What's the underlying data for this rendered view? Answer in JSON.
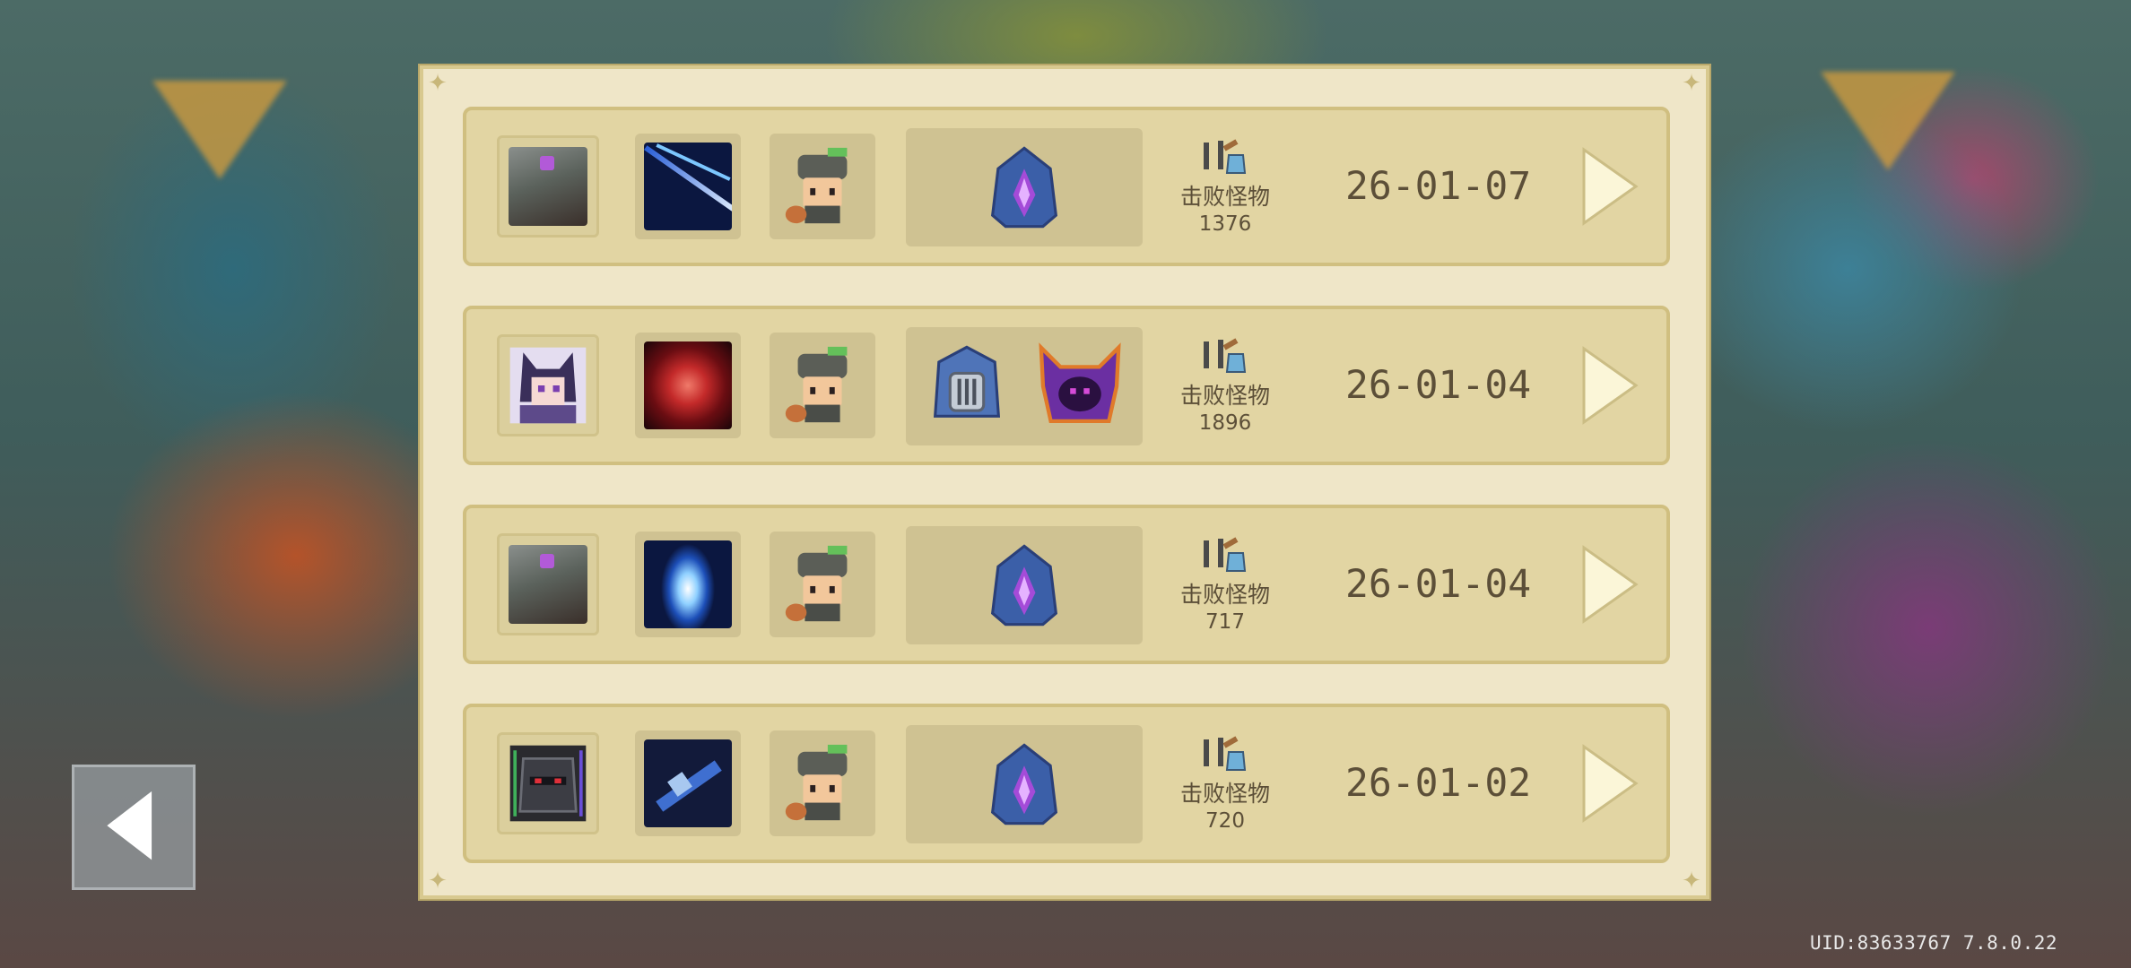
{
  "records": [
    {
      "hero": "soldier-robot-hero",
      "weapon": "lightning-spear-weapon",
      "pet": "helmet-boy-pet",
      "bosses": [
        "purple-crystal-hooded-boss"
      ],
      "kills_label": "击败怪物",
      "kills": "1376",
      "date": "26-01-07"
    },
    {
      "hero": "catgirl-hero",
      "weapon": "red-vortex-weapon",
      "pet": "helmet-boy-pet",
      "bosses": [
        "blue-knight-boss",
        "purple-horned-boss"
      ],
      "kills_label": "击败怪物",
      "kills": "1896",
      "date": "26-01-04"
    },
    {
      "hero": "soldier-robot-hero",
      "weapon": "blue-burst-weapon",
      "pet": "helmet-boy-pet",
      "bosses": [
        "purple-crystal-hooded-boss"
      ],
      "kills_label": "击败怪物",
      "kills": "717",
      "date": "26-01-04"
    },
    {
      "hero": "dark-knight-hero",
      "weapon": "blue-blaster-weapon",
      "pet": "helmet-boy-pet",
      "bosses": [
        "purple-crystal-hooded-boss"
      ],
      "kills_label": "击败怪物",
      "kills": "720",
      "date": "26-01-02"
    }
  ],
  "footer": {
    "uid_text": "UID:83633767 7.8.0.22"
  },
  "icons": {
    "back": "back-arrow-icon",
    "detail": "play-arrow-icon",
    "kills": "sword-potion-icon"
  }
}
